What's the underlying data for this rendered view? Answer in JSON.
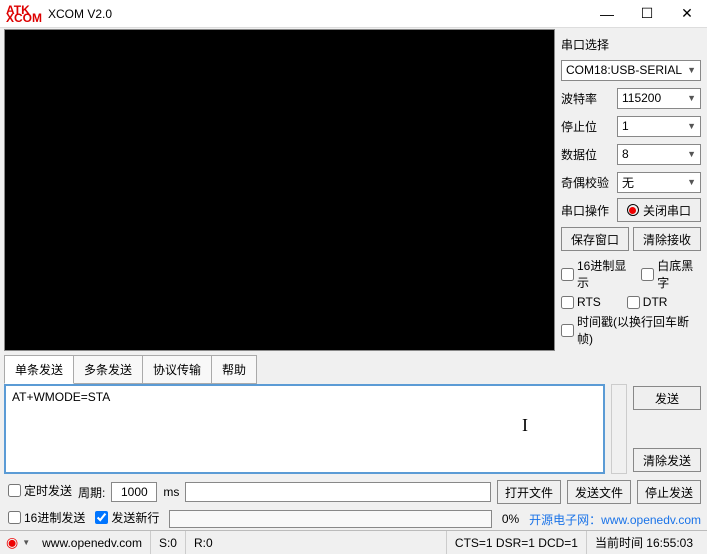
{
  "window": {
    "logo1": "ATK",
    "logo2": "XCOM",
    "title": "XCOM V2.0",
    "min": "—",
    "max": "☐",
    "close": "✕"
  },
  "serial": {
    "section": "串口选择",
    "port": "COM18:USB-SERIAL",
    "baud_label": "波特率",
    "baud": "115200",
    "stop_label": "停止位",
    "stop": "1",
    "data_label": "数据位",
    "data": "8",
    "parity_label": "奇偶校验",
    "parity": "无",
    "op_label": "串口操作",
    "close_port": "关闭串口",
    "save_window": "保存窗口",
    "clear_recv": "清除接收",
    "hex_display": "16进制显示",
    "white_bg": "白底黑字",
    "rts": "RTS",
    "dtr": "DTR",
    "timestamp": "时间戳(以换行回车断帧)"
  },
  "tabs": {
    "single": "单条发送",
    "multi": "多条发送",
    "protocol": "协议传输",
    "help": "帮助"
  },
  "send": {
    "text": "AT+WMODE=STA",
    "send_btn": "发送",
    "clear_send": "清除发送"
  },
  "opts": {
    "timed_send": "定时发送",
    "period_label": "周期:",
    "period": "1000",
    "ms": "ms",
    "open_file": "打开文件",
    "send_file": "发送文件",
    "stop_send": "停止发送",
    "hex_send": "16进制发送",
    "newline": "发送新行",
    "percent": "0%",
    "watermark": "开源电子网：www.openedv.com"
  },
  "status": {
    "url": "www.openedv.com",
    "s": "S:0",
    "r": "R:0",
    "signals": "CTS=1 DSR=1 DCD=1",
    "time": "当前时间 16:55:03"
  }
}
